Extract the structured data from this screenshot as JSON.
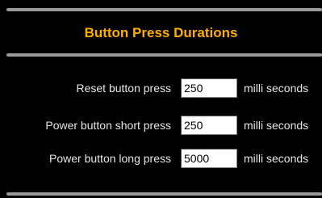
{
  "section": {
    "title": "Button Press Durations"
  },
  "rows": [
    {
      "label": "Reset button press",
      "value": "250",
      "unit": "milli seconds"
    },
    {
      "label": "Power button short press",
      "value": "250",
      "unit": "milli seconds"
    },
    {
      "label": "Power button long press",
      "value": "5000",
      "unit": "milli seconds"
    }
  ],
  "colors": {
    "title": "#ffae00",
    "background": "#000000",
    "text": "#e6e6e6",
    "rule": "#9a9a9a"
  }
}
